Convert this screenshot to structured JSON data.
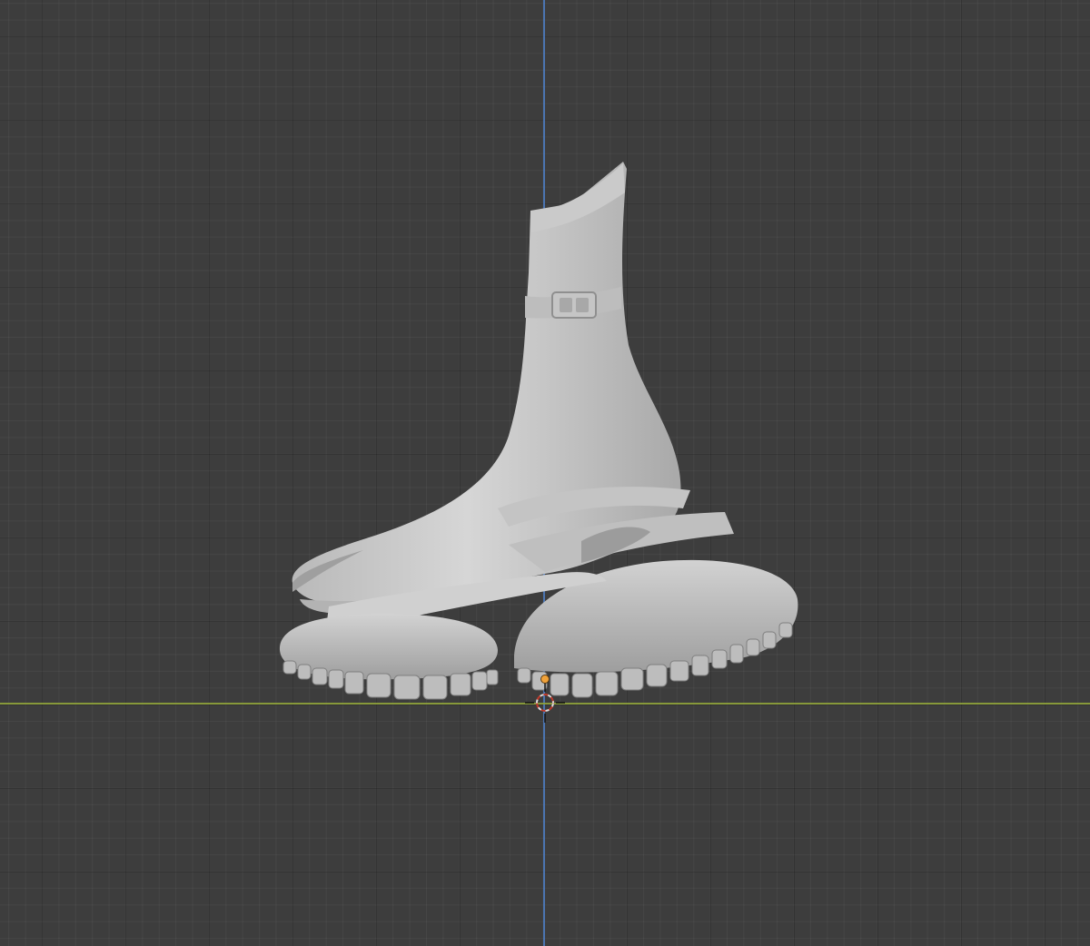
{
  "viewport": {
    "background_color": "#3d3d3d",
    "grid_color": "#2e2e2e",
    "axis_z_color": "#4f7fc7",
    "axis_y_color": "#8fa33a",
    "object_color": "#c9c9c9",
    "origin_color": "#f0a23a",
    "model_icon": "boot-mesh-icon",
    "cursor_icon": "3d-cursor-icon"
  }
}
